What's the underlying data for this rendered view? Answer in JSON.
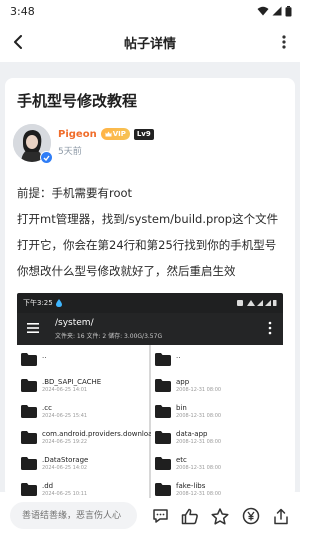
{
  "status_bar": {
    "time": "3:48"
  },
  "app_bar": {
    "title": "帖子详情"
  },
  "post": {
    "title": "手机型号修改教程",
    "author": {
      "name": "Pigeon",
      "vip_label": "VIP",
      "level": "Lv9"
    },
    "time": "5天前",
    "paragraphs": [
      "前提：手机需要有root",
      "打开mt管理器，找到/system/build.prop这个文件",
      "打开它，你会在第24行和第25行找到你的手机型号",
      "你想改什么型号修改就好了，然后重启生效"
    ]
  },
  "screenshot": {
    "status_time": "下午3:25",
    "path": "/system/",
    "info": "文件夹: 16  文件: 2  储存: 3.00G/3.57G",
    "left_rows": [
      {
        "name": "..",
        "date": ""
      },
      {
        "name": ".BD_SAPI_CACHE",
        "date": "2024-06-25 14:01"
      },
      {
        "name": ".cc",
        "date": "2024-06-25 15:41"
      },
      {
        "name": "com.android.providers.downloads.ui",
        "date": "2024-06-25 19:22"
      },
      {
        "name": ".DataStorage",
        "date": "2024-06-25 14:02"
      },
      {
        "name": ".dd",
        "date": "2024-06-25 10:11"
      }
    ],
    "right_rows": [
      {
        "name": "..",
        "date": ""
      },
      {
        "name": "app",
        "date": "2008-12-31 08:00"
      },
      {
        "name": "bin",
        "date": "2008-12-31 08:00"
      },
      {
        "name": "data-app",
        "date": "2008-12-31 08:00"
      },
      {
        "name": "etc",
        "date": "2008-12-31 08:00"
      },
      {
        "name": "fake-libs",
        "date": "2008-12-31 08:00"
      }
    ]
  },
  "bottom_bar": {
    "comment_placeholder": "善语结善缘，恶言伤人心"
  },
  "colors": {
    "accent": "#f06d2b",
    "verified": "#2f7df6",
    "screenshot_bar": "#242526",
    "folder": "#1f1f1f"
  }
}
